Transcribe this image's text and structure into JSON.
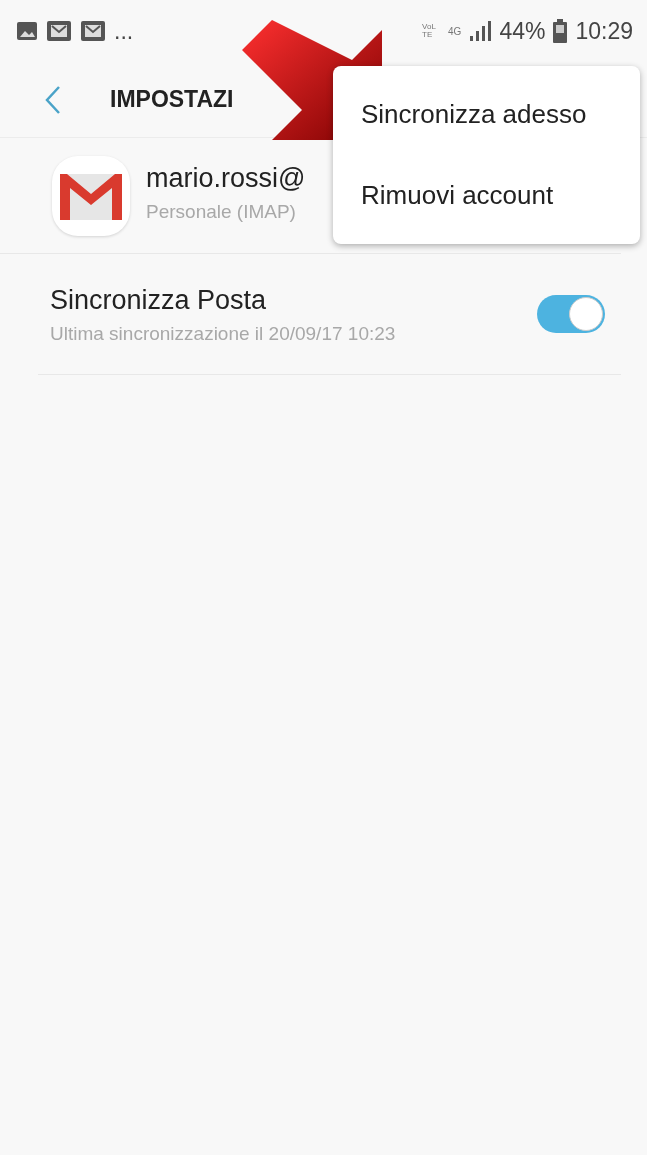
{
  "status_bar": {
    "notifications": [
      {
        "kind": "image"
      },
      {
        "kind": "mail"
      },
      {
        "kind": "mail"
      }
    ],
    "more": "...",
    "volte": "VoLTE",
    "network": "4G",
    "battery": "44%",
    "time": "10:29"
  },
  "header": {
    "title": "IMPOSTAZI"
  },
  "account": {
    "email": "mario.rossi@",
    "type": "Personale (IMAP)"
  },
  "settings": [
    {
      "title": "Sincronizza Posta",
      "subtitle": "Ultima sincronizzazione il 20/09/17  10:23",
      "on": true
    }
  ],
  "menu": {
    "items": [
      "Sincronizza adesso",
      "Rimuovi account"
    ]
  }
}
